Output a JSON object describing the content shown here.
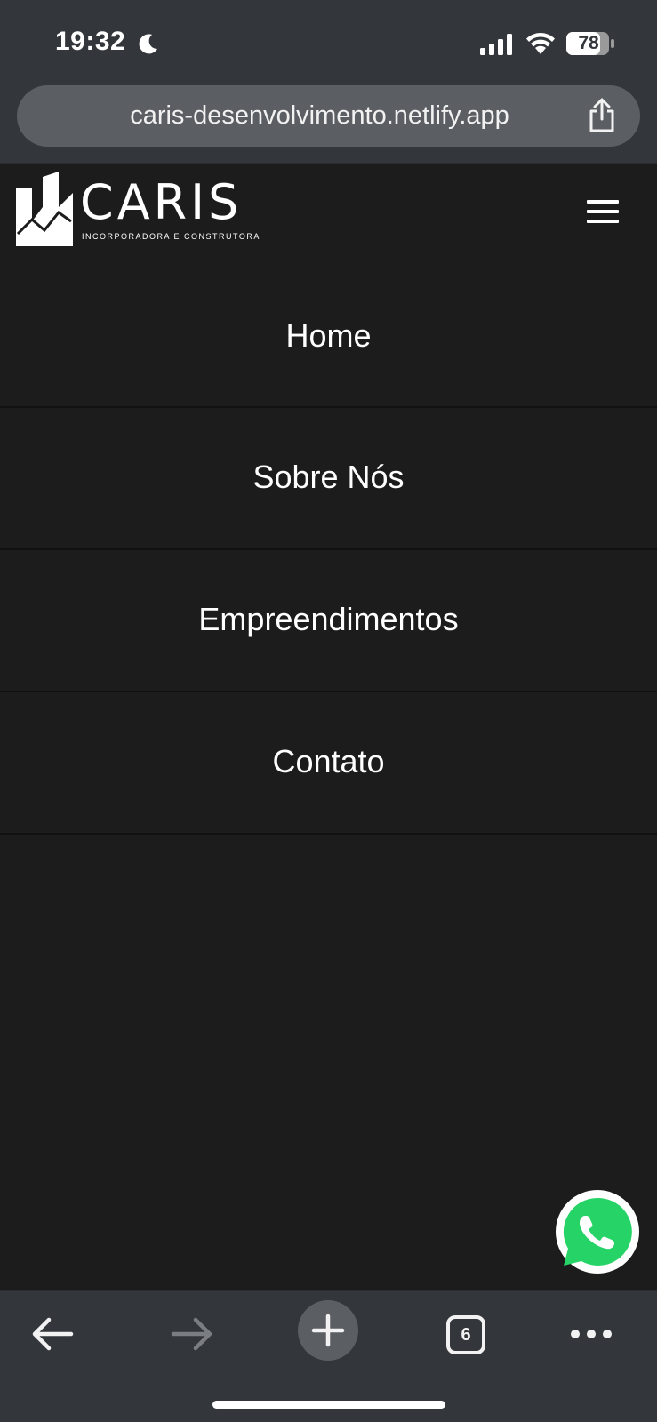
{
  "status_bar": {
    "time": "19:32",
    "battery": "78",
    "icons": [
      "moon-icon",
      "signal-icon",
      "wifi-icon",
      "battery-icon"
    ]
  },
  "browser": {
    "url": "caris-desenvolvimento.netlify.app",
    "share_icon": "share-icon",
    "tab_count": "6",
    "toolbar_icons": [
      "back-arrow-icon",
      "forward-arrow-icon",
      "plus-icon",
      "tabs-icon",
      "more-dots-icon"
    ]
  },
  "header": {
    "logo_text": "CARIS",
    "logo_subtitle": "INCORPORADORA E CONSTRUTORA",
    "menu_icon": "hamburger-icon"
  },
  "nav": {
    "items": [
      {
        "label": "Home"
      },
      {
        "label": "Sobre Nós"
      },
      {
        "label": "Empreendimentos"
      },
      {
        "label": "Contato"
      }
    ]
  },
  "floating": {
    "icon": "whatsapp-icon",
    "color": "#25d366"
  },
  "colors": {
    "page_bg": "#1c1c1c",
    "browser_chrome": "#33363a",
    "url_pill": "#5b5f64"
  }
}
